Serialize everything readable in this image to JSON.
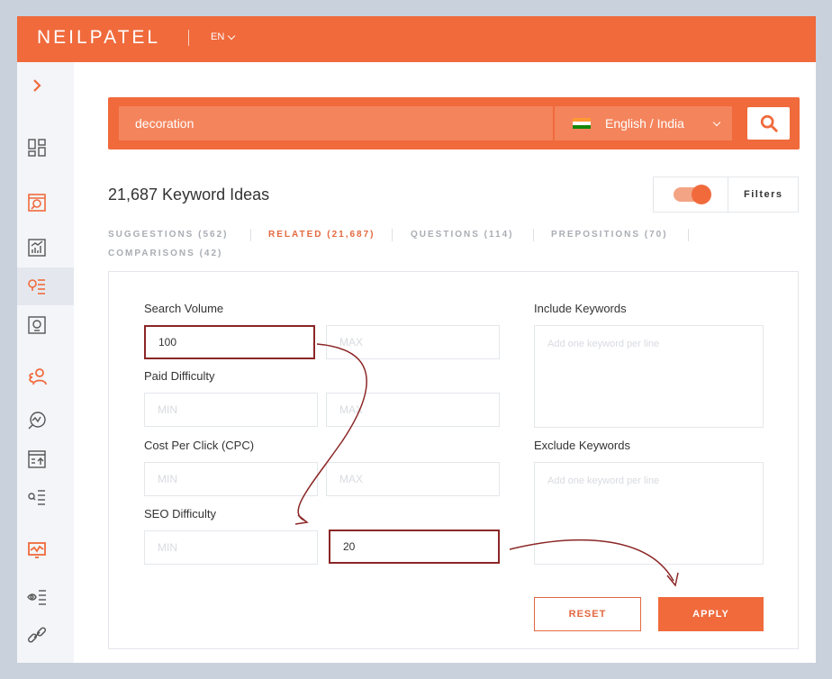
{
  "header": {
    "brand": "NEILPATEL",
    "language": "EN"
  },
  "search": {
    "value": "decoration",
    "locale": "English / India"
  },
  "results": {
    "title": "21,687 Keyword Ideas"
  },
  "filters": {
    "label": "Filters",
    "enabled": true
  },
  "tabs": [
    {
      "label": "SUGGESTIONS (562)",
      "active": false
    },
    {
      "label": "RELATED (21,687)",
      "active": true
    },
    {
      "label": "QUESTIONS (114)",
      "active": false
    },
    {
      "label": "PREPOSITIONS (70)",
      "active": false
    },
    {
      "label": "COMPARISONS (42)",
      "active": false
    }
  ],
  "panel": {
    "search_volume": {
      "label": "Search Volume",
      "min_value": "100",
      "max_placeholder": "MAX"
    },
    "paid_difficulty": {
      "label": "Paid Difficulty",
      "min_placeholder": "MIN",
      "max_placeholder": "MAX"
    },
    "cpc": {
      "label": "Cost Per Click (CPC)",
      "min_placeholder": "MIN",
      "max_placeholder": "MAX"
    },
    "seo_difficulty": {
      "label": "SEO Difficulty",
      "min_placeholder": "MIN",
      "max_value": "20"
    },
    "include_keywords": {
      "label": "Include Keywords",
      "placeholder": "Add one keyword per line"
    },
    "exclude_keywords": {
      "label": "Exclude Keywords",
      "placeholder": "Add one keyword per line"
    },
    "reset_label": "RESET",
    "apply_label": "APPLY"
  },
  "colors": {
    "brand": "#f06a3c",
    "highlight": "#8b2626"
  },
  "sidebar_icons": [
    "expand-chevron-icon",
    "dashboard-icon",
    "site-audit-icon",
    "traffic-analyzer-icon",
    "keyword-ideas-icon",
    "content-ideas-icon",
    "competitors-icon",
    "backlinks-icon",
    "rank-tracker-icon",
    "keyword-list-icon",
    "monitor-icon",
    "lists-icon",
    "link-icon"
  ]
}
